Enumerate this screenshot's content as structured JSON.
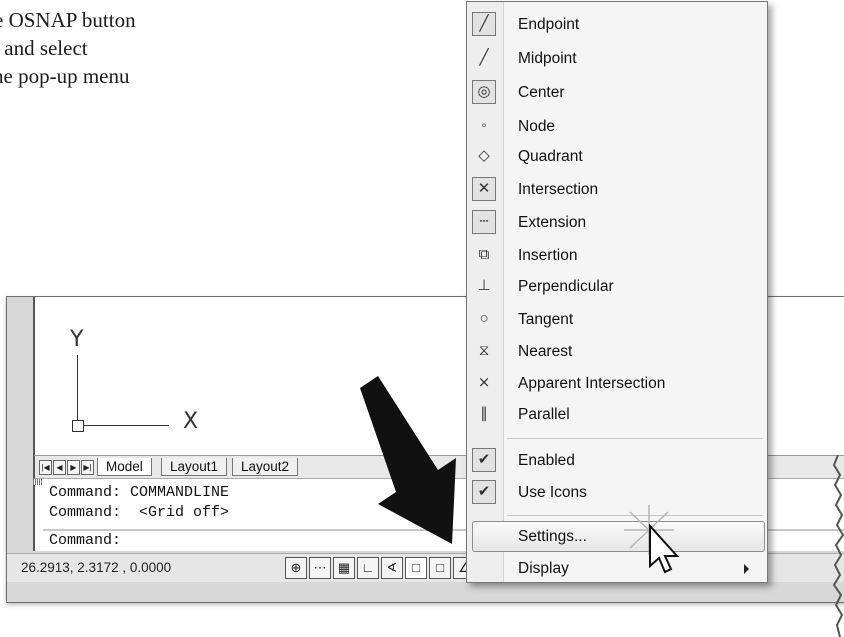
{
  "instructions": {
    "line1": "e OSNAP button",
    "line2": "r and select",
    "line3": "he pop-up menu"
  },
  "drawing": {
    "ucs_y": "Y",
    "ucs_x": "X"
  },
  "layout_tabs": [
    "Model",
    "Layout1",
    "Layout2"
  ],
  "command_lines": {
    "line1": "Command: COMMANDLINE",
    "line2": "Command:  <Grid off>",
    "prompt": "Command:"
  },
  "status_bar": {
    "coordinates": "26.2913, 2.3172 , 0.0000"
  },
  "menu": {
    "snap_items": [
      {
        "label": "Endpoint",
        "icon": "endpoint-icon",
        "glyph": "╱"
      },
      {
        "label": "Midpoint",
        "icon": "midpoint-icon",
        "glyph": "╱"
      },
      {
        "label": "Center",
        "icon": "center-icon",
        "glyph": "◎"
      },
      {
        "label": "Node",
        "icon": "node-icon",
        "glyph": "◦"
      },
      {
        "label": "Quadrant",
        "icon": "quadrant-icon",
        "glyph": "◇"
      },
      {
        "label": "Intersection",
        "icon": "intersection-icon",
        "glyph": "✕"
      },
      {
        "label": "Extension",
        "icon": "extension-icon",
        "glyph": "┄"
      },
      {
        "label": "Insertion",
        "icon": "insertion-icon",
        "glyph": "⧉"
      },
      {
        "label": "Perpendicular",
        "icon": "perpendicular-icon",
        "glyph": "⊥"
      },
      {
        "label": "Tangent",
        "icon": "tangent-icon",
        "glyph": "○"
      },
      {
        "label": "Nearest",
        "icon": "nearest-icon",
        "glyph": "⧖"
      },
      {
        "label": "Apparent Intersection",
        "icon": "apparent-intersection-icon",
        "glyph": "⨯"
      },
      {
        "label": "Parallel",
        "icon": "parallel-icon",
        "glyph": "∥"
      }
    ],
    "enabled_label": "Enabled",
    "use_icons_label": "Use Icons",
    "check_glyph": "✔",
    "settings_label": "Settings...",
    "display_label": "Display"
  }
}
